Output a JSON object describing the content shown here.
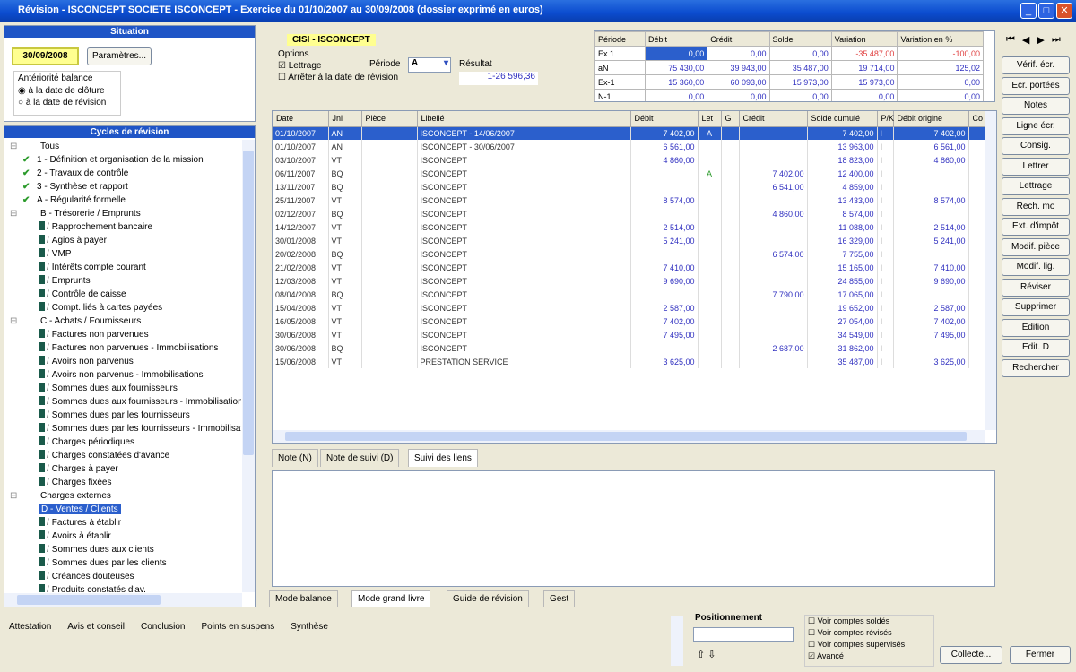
{
  "window": {
    "title": "Révision - ISCONCEPT SOCIETE ISCONCEPT - Exercice du 01/10/2007 au 30/09/2008 (dossier exprimé en euros)",
    "min": "_",
    "max": "□",
    "close": "✕"
  },
  "situation": {
    "header": "Situation",
    "date": "30/09/2008",
    "params_button": "Paramètres...",
    "group_label": "Antériorité balance",
    "radio1": "à la date de clôture",
    "radio2": "à la date de révision"
  },
  "tree": {
    "header": "Cycles de révision",
    "items": [
      {
        "label": "Tous",
        "kind": "root"
      },
      {
        "label": "1 - Définition et organisation de la mission",
        "kind": "check"
      },
      {
        "label": "2 - Travaux de contrôle",
        "kind": "check"
      },
      {
        "label": "3 - Synthèse et rapport",
        "kind": "check"
      },
      {
        "label": "A - Régularité formelle",
        "kind": "check"
      },
      {
        "label": "B - Trésorerie / Emprunts",
        "kind": "group"
      },
      {
        "label": "Rapprochement bancaire",
        "kind": "leaf"
      },
      {
        "label": "Agios à payer",
        "kind": "leaf"
      },
      {
        "label": "VMP",
        "kind": "leaf"
      },
      {
        "label": "Intérêts compte courant",
        "kind": "leaf"
      },
      {
        "label": "Emprunts",
        "kind": "leaf"
      },
      {
        "label": "Contrôle de caisse",
        "kind": "leaf"
      },
      {
        "label": "Compt. liés à cartes payées",
        "kind": "leaf"
      },
      {
        "label": "C - Achats / Fournisseurs",
        "kind": "group"
      },
      {
        "label": "Factures non parvenues",
        "kind": "leaf"
      },
      {
        "label": "Factures non parvenues - Immobilisations",
        "kind": "leaf"
      },
      {
        "label": "Avoirs non parvenus",
        "kind": "leaf"
      },
      {
        "label": "Avoirs non parvenus - Immobilisations",
        "kind": "leaf"
      },
      {
        "label": "Sommes dues aux fournisseurs",
        "kind": "leaf"
      },
      {
        "label": "Sommes dues aux fournisseurs - Immobilisations",
        "kind": "leaf"
      },
      {
        "label": "Sommes dues par les fournisseurs",
        "kind": "leaf"
      },
      {
        "label": "Sommes dues par les fournisseurs - Immobilisations",
        "kind": "leaf"
      },
      {
        "label": "Charges périodiques",
        "kind": "leaf"
      },
      {
        "label": "Charges constatées d'avance",
        "kind": "leaf"
      },
      {
        "label": "Charges à payer",
        "kind": "leaf"
      },
      {
        "label": "Charges fixées",
        "kind": "leaf"
      },
      {
        "label": "Charges externes",
        "kind": "group"
      },
      {
        "label": "D - Ventes / Clients",
        "kind": "selected"
      },
      {
        "label": "Factures à établir",
        "kind": "leaf"
      },
      {
        "label": "Avoirs à établir",
        "kind": "leaf"
      },
      {
        "label": "Sommes dues aux clients",
        "kind": "leaf"
      },
      {
        "label": "Sommes dues par les clients",
        "kind": "leaf"
      },
      {
        "label": "Créances douteuses",
        "kind": "leaf"
      },
      {
        "label": "Produits constatés d'av.",
        "kind": "leaf"
      }
    ]
  },
  "account": {
    "label": "CISI - ISCONCEPT",
    "options_label": "Options",
    "lettrage": "Lettrage",
    "arreter": "Arrêter à la date de révision",
    "periode_label": "Période",
    "periode_value": "A",
    "resultat_label": "Résultat",
    "resultat_value": "1-26 596,36"
  },
  "stats": {
    "headers": [
      "Période",
      "Débit",
      "Crédit",
      "Solde",
      "Variation",
      "Variation en %"
    ],
    "rows": [
      [
        "Ex 1",
        "0,00",
        "0,00",
        "0,00",
        "-35 487,00",
        "-100,00"
      ],
      [
        "aN",
        "75 430,00",
        "39 943,00",
        "35 487,00",
        "19 714,00",
        "125,02"
      ],
      [
        "Ex-1",
        "15 360,00",
        "60 093,00",
        "15 973,00",
        "15 973,00",
        "0,00"
      ],
      [
        "N-1",
        "0,00",
        "0,00",
        "0,00",
        "0,00",
        "0,00"
      ]
    ]
  },
  "nav": {
    "first": "⏮",
    "prev": "◀",
    "next": "▶",
    "last": "⏭"
  },
  "grid": {
    "headers": [
      "Date",
      "Jnl",
      "Pièce",
      "Libellé",
      "Débit",
      "Let",
      "G",
      "Crédit",
      "Solde cumulé",
      "P/K",
      "Débit origine",
      "Co"
    ],
    "rows": [
      [
        "01/10/2007",
        "AN",
        "",
        "ISCONCEPT - 14/06/2007",
        "7 402,00",
        "A",
        "",
        "",
        "7 402,00",
        "I",
        "7 402,00"
      ],
      [
        "01/10/2007",
        "AN",
        "",
        "ISCONCEPT - 30/06/2007",
        "6 561,00",
        "",
        "",
        "",
        "13 963,00",
        "I",
        "6 561,00"
      ],
      [
        "03/10/2007",
        "VT",
        "",
        "ISCONCEPT",
        "4 860,00",
        "",
        "",
        "",
        "18 823,00",
        "I",
        "4 860,00"
      ],
      [
        "06/11/2007",
        "BQ",
        "",
        "ISCONCEPT",
        "",
        "A",
        "",
        "7 402,00",
        "12 400,00",
        "I",
        ""
      ],
      [
        "13/11/2007",
        "BQ",
        "",
        "ISCONCEPT",
        "",
        "",
        "",
        "6 541,00",
        "4 859,00",
        "I",
        ""
      ],
      [
        "25/11/2007",
        "VT",
        "",
        "ISCONCEPT",
        "8 574,00",
        "",
        "",
        "",
        "13 433,00",
        "I",
        "8 574,00"
      ],
      [
        "02/12/2007",
        "BQ",
        "",
        "ISCONCEPT",
        "",
        "",
        "",
        "4 860,00",
        "8 574,00",
        "I",
        ""
      ],
      [
        "14/12/2007",
        "VT",
        "",
        "ISCONCEPT",
        "2 514,00",
        "",
        "",
        "",
        "11 088,00",
        "I",
        "2 514,00"
      ],
      [
        "30/01/2008",
        "VT",
        "",
        "ISCONCEPT",
        "5 241,00",
        "",
        "",
        "",
        "16 329,00",
        "I",
        "5 241,00"
      ],
      [
        "20/02/2008",
        "BQ",
        "",
        "ISCONCEPT",
        "",
        "",
        "",
        "6 574,00",
        "7 755,00",
        "I",
        ""
      ],
      [
        "21/02/2008",
        "VT",
        "",
        "ISCONCEPT",
        "7 410,00",
        "",
        "",
        "",
        "15 165,00",
        "I",
        "7 410,00"
      ],
      [
        "12/03/2008",
        "VT",
        "",
        "ISCONCEPT",
        "9 690,00",
        "",
        "",
        "",
        "24 855,00",
        "I",
        "9 690,00"
      ],
      [
        "08/04/2008",
        "BQ",
        "",
        "ISCONCEPT",
        "",
        "",
        "",
        "7 790,00",
        "17 065,00",
        "I",
        ""
      ],
      [
        "15/04/2008",
        "VT",
        "",
        "ISCONCEPT",
        "2 587,00",
        "",
        "",
        "",
        "19 652,00",
        "I",
        "2 587,00"
      ],
      [
        "16/05/2008",
        "VT",
        "",
        "ISCONCEPT",
        "7 402,00",
        "",
        "",
        "",
        "27 054,00",
        "I",
        "7 402,00"
      ],
      [
        "30/06/2008",
        "VT",
        "",
        "ISCONCEPT",
        "7 495,00",
        "",
        "",
        "",
        "34 549,00",
        "I",
        "7 495,00"
      ],
      [
        "30/06/2008",
        "BQ",
        "",
        "ISCONCEPT",
        "",
        "",
        "",
        "2 687,00",
        "31 862,00",
        "I",
        ""
      ],
      [
        "15/06/2008",
        "VT",
        "",
        "PRESTATION SERVICE",
        "3 625,00",
        "",
        "",
        "",
        "35 487,00",
        "I",
        "3 625,00"
      ]
    ]
  },
  "right_buttons": [
    "Vérif. écr.",
    "Ecr. portées",
    "Notes",
    "Ligne écr.",
    "Consig.",
    "Lettrer",
    "Lettrage",
    "Rech. mo",
    "Ext. d'impôt",
    "Modif. pièce",
    "Modif. lig.",
    "Réviser",
    "Supprimer",
    "Edition",
    "Edit. D",
    "Rechercher"
  ],
  "note_tabs": [
    "Note (N)",
    "Note de suivi (D)",
    "Suivi des liens"
  ],
  "mode_tabs": [
    "Mode balance",
    "Mode grand livre",
    "Guide de révision",
    "Gest"
  ],
  "bottom_toolbar": [
    "Attestation",
    "Avis et conseil",
    "Conclusion",
    "Points en suspens",
    "Synthèse"
  ],
  "positionnement": {
    "label": "Positionnement",
    "value": ""
  },
  "filters": [
    "Voir comptes soldés",
    "Voir comptes révisés",
    "Voir comptes supervisés",
    "Avancé"
  ],
  "footer": {
    "collecte": "Collecte...",
    "fermer": "Fermer"
  }
}
